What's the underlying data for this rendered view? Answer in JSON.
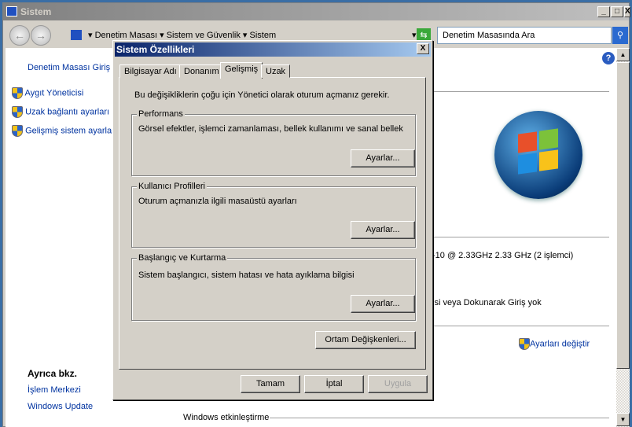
{
  "window": {
    "title": "Sistem",
    "minimize": "_",
    "maximize": "□",
    "close": "X"
  },
  "address": {
    "crumbs": [
      "Denetim Masası",
      "Sistem ve Güvenlik",
      "Sistem"
    ],
    "search_placeholder": "Denetim Masasında Ara"
  },
  "sidebar": {
    "home": "Denetim Masası Giriş",
    "items": [
      "Aygıt Yöneticisi",
      "Uzak bağlantı ayarları",
      "Gelişmiş sistem ayarları"
    ],
    "see_also_title": "Ayrıca bkz.",
    "see_also": [
      "İşlem Merkezi",
      "Windows Update"
    ]
  },
  "main": {
    "processor_text": "-10  @ 2.33GHz   2.33 GHz  (2 işlemci)",
    "pen_text": "isi veya Dokunarak Giriş yok",
    "change_settings": "Ayarları değiştir",
    "activation": "Windows etkinleştirme"
  },
  "dialog": {
    "title": "Sistem Özellikleri",
    "close": "X",
    "tabs": [
      "Bilgisayar Adı",
      "Donanım",
      "Gelişmiş",
      "Uzak"
    ],
    "active_tab": "Gelişmiş",
    "admin_note": "Bu değişikliklerin çoğu için Yönetici olarak oturum açmanız gerekir.",
    "groups": [
      {
        "title": "Performans",
        "desc": "Görsel efektler, işlemci zamanlaması, bellek kullanımı ve sanal bellek",
        "button": "Ayarlar..."
      },
      {
        "title": "Kullanıcı Profilleri",
        "desc": "Oturum açmanızla ilgili masaüstü ayarları",
        "button": "Ayarlar..."
      },
      {
        "title": "Başlangıç ve Kurtarma",
        "desc": "Sistem başlangıcı, sistem hatası ve hata ayıklama bilgisi",
        "button": "Ayarlar..."
      }
    ],
    "env_button": "Ortam Değişkenleri...",
    "ok": "Tamam",
    "cancel": "İptal",
    "apply": "Uygula"
  }
}
